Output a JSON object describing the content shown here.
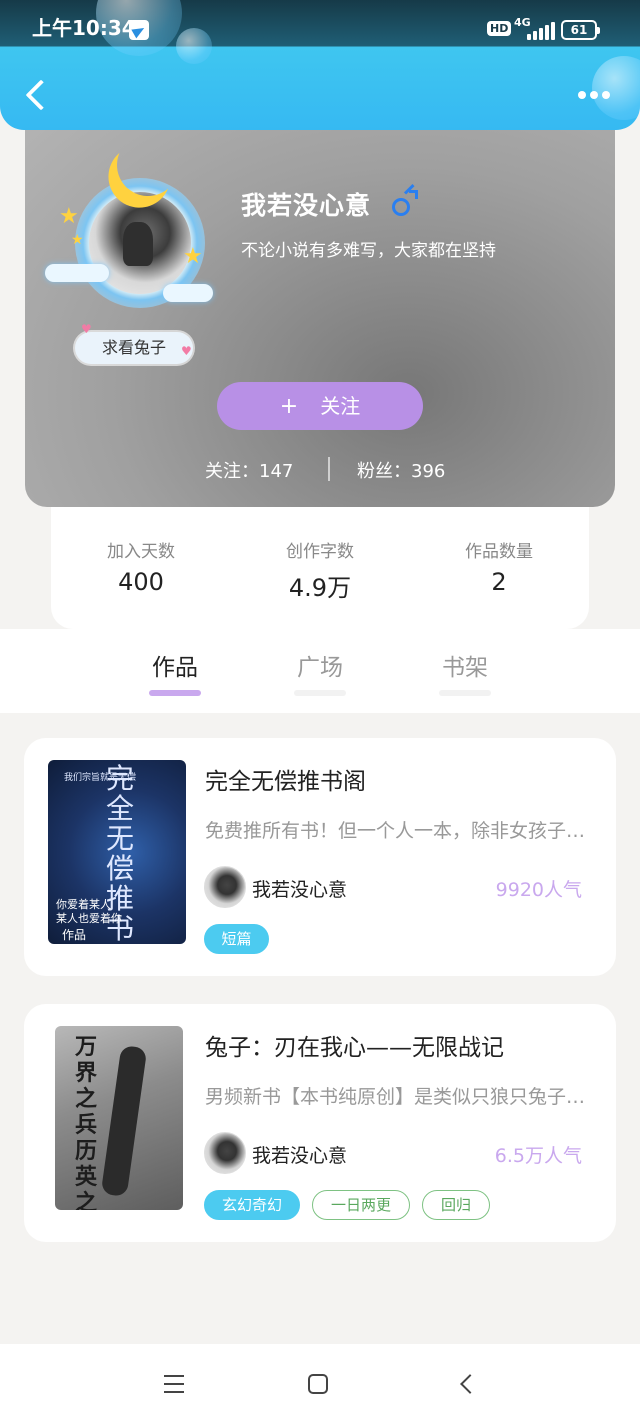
{
  "status_bar": {
    "time": "上午10:34",
    "hd": "HD",
    "network": "4G",
    "battery": "61"
  },
  "profile": {
    "name": "我若没心意",
    "signature": "不论小说有多难写，大家都在坚持",
    "badge": "求看兔子",
    "follow_button": {
      "icon": "+",
      "label": "关注"
    },
    "following": "关注：147",
    "fans": "粉丝：396"
  },
  "summary": [
    {
      "label": "加入天数",
      "value": "400"
    },
    {
      "label": "创作字数",
      "value": "4.9万"
    },
    {
      "label": "作品数量",
      "value": "2"
    }
  ],
  "tabs": [
    {
      "label": "作品",
      "active": true
    },
    {
      "label": "广场",
      "active": false
    },
    {
      "label": "书架",
      "active": false
    }
  ],
  "books": [
    {
      "title": "完全无偿推书阁",
      "description": "免费推所有书！但一个人一本，除非女孩子…",
      "author": "我若没心意",
      "popularity": "9920人气",
      "tags": [
        "短篇"
      ],
      "cover_texts": {
        "top": "我们宗旨就是无偿",
        "main": "完全无偿推书阁",
        "bottom1": "你爱着某人",
        "bottom2": "某人也爱着你",
        "bottom3": "作品"
      }
    },
    {
      "title": "兔子：刃在我心——无限战记",
      "description": "男频新书【本书纯原创】是类似只狼只兔子的…",
      "author": "我若没心意",
      "popularity": "6.5万人气",
      "tags": [
        "玄幻奇幻",
        "一日两更",
        "回归"
      ],
      "cover_texts": {
        "main": "万界之兵历英之传"
      }
    }
  ],
  "colors": {
    "accent": "#b890e6",
    "header": "#3fc6f0",
    "tag_blue": "#4ccbf0",
    "tag_green": "#7ec283",
    "popularity": "#c9a8ee"
  },
  "icons": {
    "back": "back-arrow-icon",
    "more": "more-dots-icon",
    "gender": "male-icon",
    "nav": [
      "menu-icon",
      "home-icon",
      "back-icon"
    ]
  }
}
